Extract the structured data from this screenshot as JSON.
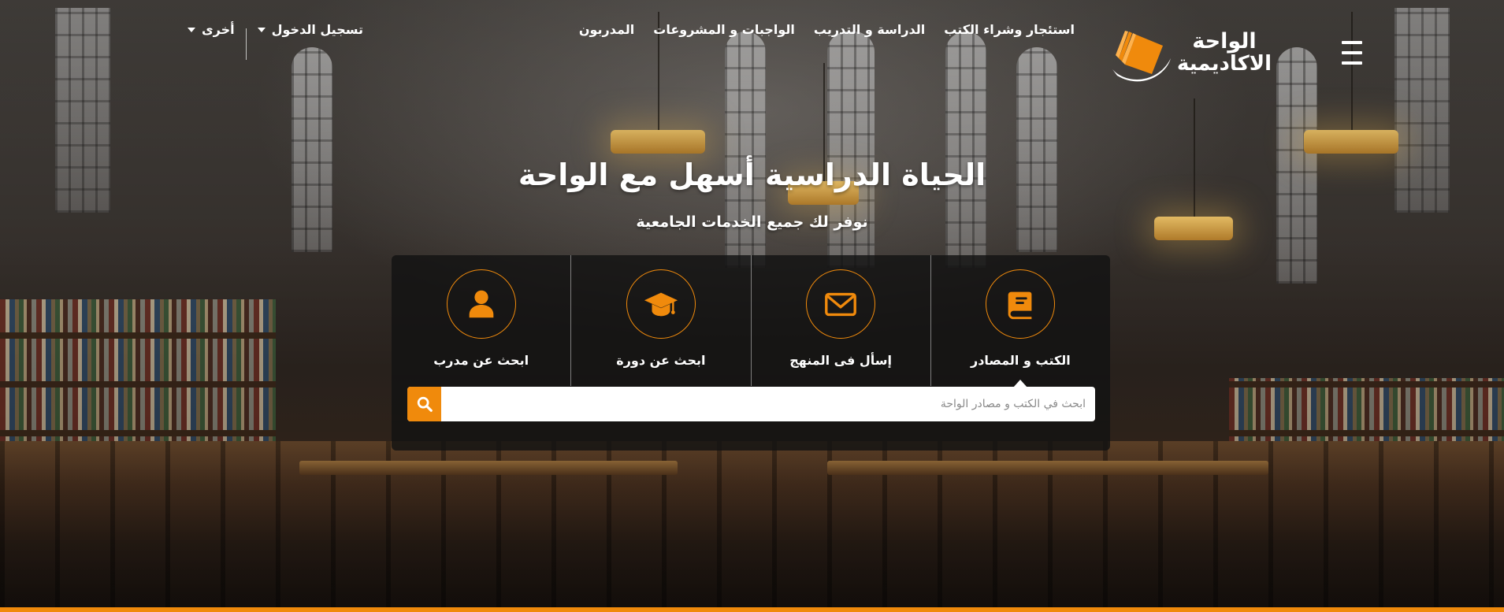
{
  "header": {
    "logo": {
      "line1": "الواحة",
      "line2": "الاكاديمية"
    },
    "nav": [
      {
        "label": "استئجار وشراء الكتب"
      },
      {
        "label": "الدراسة و التدريب"
      },
      {
        "label": "الواجبات و المشروعات"
      },
      {
        "label": "المدربون"
      }
    ],
    "login_label": "تسجيل الدخول",
    "other_label": "أخرى"
  },
  "hero": {
    "title": "الحياة الدراسية أسهل مع الواحة",
    "subtitle": "نوفر لك جميع الخدمات الجامعية"
  },
  "search": {
    "tabs": [
      {
        "label": "الكتب و المصادر",
        "icon": "book-icon",
        "active": true
      },
      {
        "label": "إسأل فى المنهج",
        "icon": "envelope-icon",
        "active": false
      },
      {
        "label": "ابحث عن دورة",
        "icon": "graduation-cap-icon",
        "active": false
      },
      {
        "label": "ابحث عن مدرب",
        "icon": "user-icon",
        "active": false
      }
    ],
    "placeholder": "ابحث في الكتب و مصادر الواحة"
  },
  "colors": {
    "accent": "#f08a0c",
    "panel": "#121212"
  }
}
